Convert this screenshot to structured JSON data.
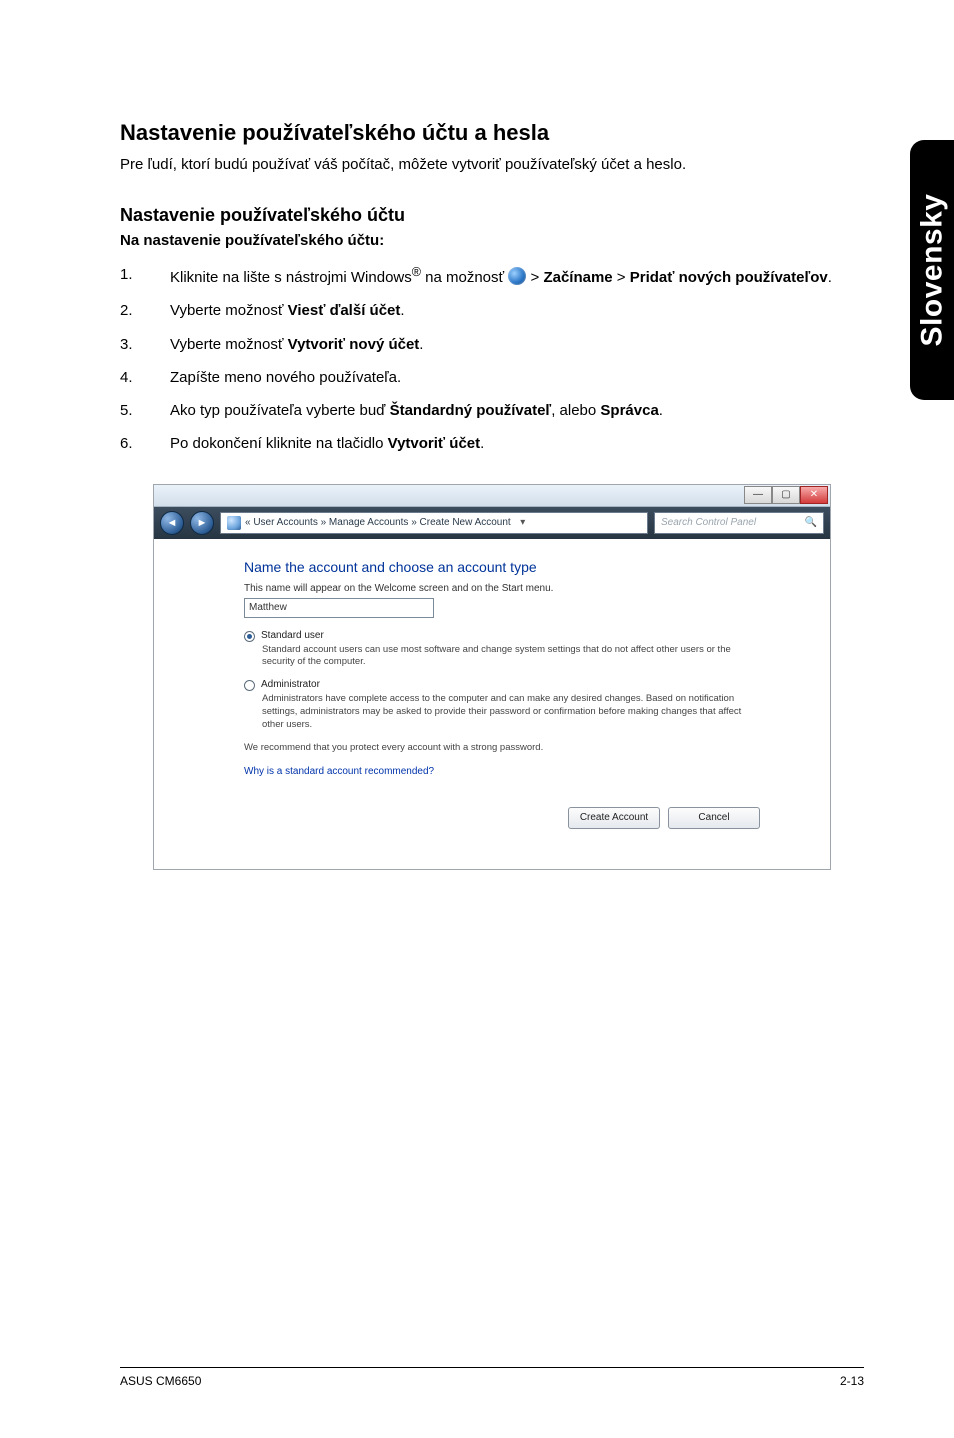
{
  "side_tab": "Slovensky",
  "heading_main": "Nastavenie používateľského účtu a hesla",
  "intro": "Pre ľudí, ktorí budú používať váš počítač, môžete vytvoriť používateľský účet a heslo.",
  "heading_sub": "Nastavenie používateľského účtu",
  "steps_label": "Na nastavenie používateľského účtu:",
  "step1_a": "Kliknite na lište s nástrojmi Windows",
  "step1_reg": "®",
  "step1_b": " na možnosť ",
  "step1_c": " > ",
  "step1_bold1": "Začíname",
  "step1_d": " > ",
  "step1_bold2": "Pridať nových používateľov",
  "step1_e": ".",
  "step2_a": "Vyberte možnosť ",
  "step2_bold": "Viesť ďalší účet",
  "step2_b": ".",
  "step3_a": "Vyberte možnosť ",
  "step3_bold": "Vytvoriť nový účet",
  "step3_b": ".",
  "step4": "Zapíšte meno nového používateľa.",
  "step5_a": "Ako typ používateľa vyberte buď ",
  "step5_bold1": "Štandardný používateľ",
  "step5_b": ", alebo ",
  "step5_bold2": "Správca",
  "step5_c": ".",
  "step6_a": "Po dokončení kliknite na tlačidlo ",
  "step6_bold": "Vytvoriť účet",
  "step6_b": ".",
  "dialog": {
    "breadcrumb": "« User Accounts » Manage Accounts » Create New Account",
    "search_placeholder": "Search Control Panel",
    "heading": "Name the account and choose an account type",
    "sub": "This name will appear on the Welcome screen and on the Start menu.",
    "input_value": "Matthew",
    "radio1_label": "Standard user",
    "radio1_desc": "Standard account users can use most software and change system settings that do not affect other users or the security of the computer.",
    "radio2_label": "Administrator",
    "radio2_desc": "Administrators have complete access to the computer and can make any desired changes. Based on notification settings, administrators may be asked to provide their password or confirmation before making changes that affect other users.",
    "recommend": "We recommend that you protect every account with a strong password.",
    "why_link": "Why is a standard account recommended?",
    "btn_create": "Create Account",
    "btn_cancel": "Cancel"
  },
  "footer_left": "ASUS CM6650",
  "footer_right": "2-13"
}
